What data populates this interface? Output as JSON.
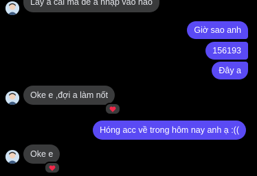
{
  "messages": [
    {
      "id": "m1",
      "side": "in",
      "text": "Lấy a cái mã để a nhập vào nào"
    },
    {
      "id": "m2",
      "side": "out",
      "text": "Giờ sao anh"
    },
    {
      "id": "m3",
      "side": "out",
      "text": "156193"
    },
    {
      "id": "m4",
      "side": "out",
      "text": "Đây a"
    },
    {
      "id": "m5",
      "side": "in",
      "text": "Oke e ,đợi a làm nốt",
      "reaction": "heart-icon"
    },
    {
      "id": "m6",
      "side": "out",
      "text": "Hóng acc về trong hôm nay anh ạ :(("
    },
    {
      "id": "m7",
      "side": "in",
      "text": "Oke e",
      "reaction": "heart-icon"
    }
  ],
  "colors": {
    "background": "#000000",
    "incoming_bubble": "#3a3b3c",
    "outgoing_bubble": "#5a4af4",
    "heart": "#f0284a"
  }
}
